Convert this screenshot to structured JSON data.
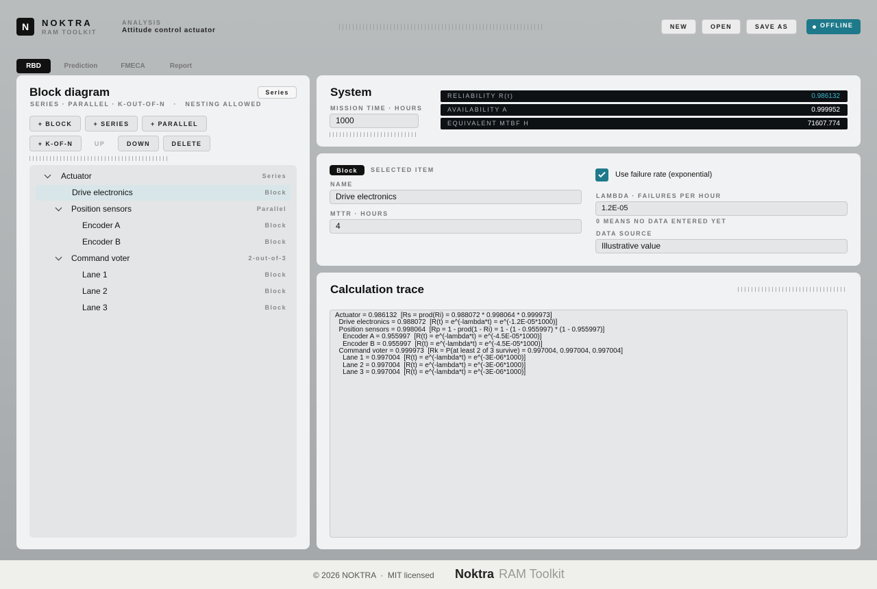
{
  "app": {
    "logo_letter": "N",
    "brand_name": "NOKTRA",
    "brand_sub": "RAM TOOLKIT",
    "analysis_label": "ANALYSIS",
    "analysis_title": "Attitude control actuator"
  },
  "toolbar": {
    "new_label": "NEW",
    "open_label": "OPEN",
    "save_as_label": "SAVE AS",
    "status_label": "OFFLINE"
  },
  "tabs": [
    {
      "label": "RBD",
      "active": true
    },
    {
      "label": "Prediction",
      "active": false
    },
    {
      "label": "FMECA",
      "active": false
    },
    {
      "label": "Report",
      "active": false
    }
  ],
  "block_diagram": {
    "title": "Block diagram",
    "mode_badge": "Series",
    "subtitle": "SERIES · PARALLEL · K-OUT-OF-N   ·   NESTING ALLOWED",
    "buttons": {
      "add_block": "+ BLOCK",
      "add_series": "+ SERIES",
      "add_parallel": "+ PARALLEL",
      "add_kofn": "+ K-OF-N",
      "up": "UP",
      "down": "DOWN",
      "delete": "DELETE"
    },
    "tree": [
      {
        "label": "Actuator",
        "type": "Series",
        "level": 0,
        "expanded": true,
        "selected": false
      },
      {
        "label": "Drive electronics",
        "type": "Block",
        "level": 1,
        "expanded": false,
        "selected": true
      },
      {
        "label": "Position sensors",
        "type": "Parallel",
        "level": 1,
        "expanded": true,
        "selected": false
      },
      {
        "label": "Encoder A",
        "type": "Block",
        "level": 2,
        "expanded": false,
        "selected": false
      },
      {
        "label": "Encoder B",
        "type": "Block",
        "level": 2,
        "expanded": false,
        "selected": false
      },
      {
        "label": "Command voter",
        "type": "2-out-of-3",
        "level": 1,
        "expanded": true,
        "selected": false
      },
      {
        "label": "Lane 1",
        "type": "Block",
        "level": 2,
        "expanded": false,
        "selected": false
      },
      {
        "label": "Lane 2",
        "type": "Block",
        "level": 2,
        "expanded": false,
        "selected": false
      },
      {
        "label": "Lane 3",
        "type": "Block",
        "level": 2,
        "expanded": false,
        "selected": false
      }
    ]
  },
  "system": {
    "title": "System",
    "mission_label": "MISSION TIME · HOURS",
    "mission_value": "1000",
    "metrics": [
      {
        "label": "RELIABILITY  R(t)",
        "value": "0.986132",
        "color": "#39b7cc"
      },
      {
        "label": "AVAILABILITY  A",
        "value": "0.999952",
        "color": "#ffffff"
      },
      {
        "label": "EQUIVALENT MTBF  H",
        "value": "71607.774",
        "color": "#ffffff"
      }
    ]
  },
  "item": {
    "badge": "Block",
    "selected_label": "SELECTED ITEM",
    "name_label": "NAME",
    "name_value": "Drive electronics",
    "mttr_label": "MTTR · HOURS",
    "mttr_value": "4",
    "use_failure_rate_label": "Use failure rate (exponential)",
    "use_failure_rate_checked": true,
    "lambda_label": "LAMBDA · FAILURES PER HOUR",
    "lambda_value": "1.2E-05",
    "lambda_hint": "0 MEANS NO DATA ENTERED YET",
    "source_label": "DATA SOURCE",
    "source_value": "Illustrative value"
  },
  "trace": {
    "title": "Calculation trace",
    "lines": [
      "Actuator = 0.986132  [Rs = prod(Ri) = 0.988072 * 0.998064 * 0.999973]",
      "  Drive electronics = 0.988072  [R(t) = e^(-lambda*t) = e^(-1.2E-05*1000)]",
      "  Position sensors = 0.998064  [Rp = 1 - prod(1 - Ri) = 1 - (1 - 0.955997) * (1 - 0.955997)]",
      "    Encoder A = 0.955997  [R(t) = e^(-lambda*t) = e^(-4.5E-05*1000)]",
      "    Encoder B = 0.955997  [R(t) = e^(-lambda*t) = e^(-4.5E-05*1000)]",
      "  Command voter = 0.999973  [Rk = P(at least 2 of 3 survive) = 0.997004, 0.997004, 0.997004]",
      "    Lane 1 = 0.997004  [R(t) = e^(-lambda*t) = e^(-3E-06*1000)]",
      "    Lane 2 = 0.997004  [R(t) = e^(-lambda*t) = e^(-3E-06*1000)]",
      "    Lane 3 = 0.997004  [R(t) = e^(-lambda*t) = e^(-3E-06*1000)]"
    ]
  },
  "footer": {
    "copyright": "© 2026 NOKTRA  ·  MIT licensed",
    "brand": "Noktra",
    "product": "RAM Toolkit"
  }
}
